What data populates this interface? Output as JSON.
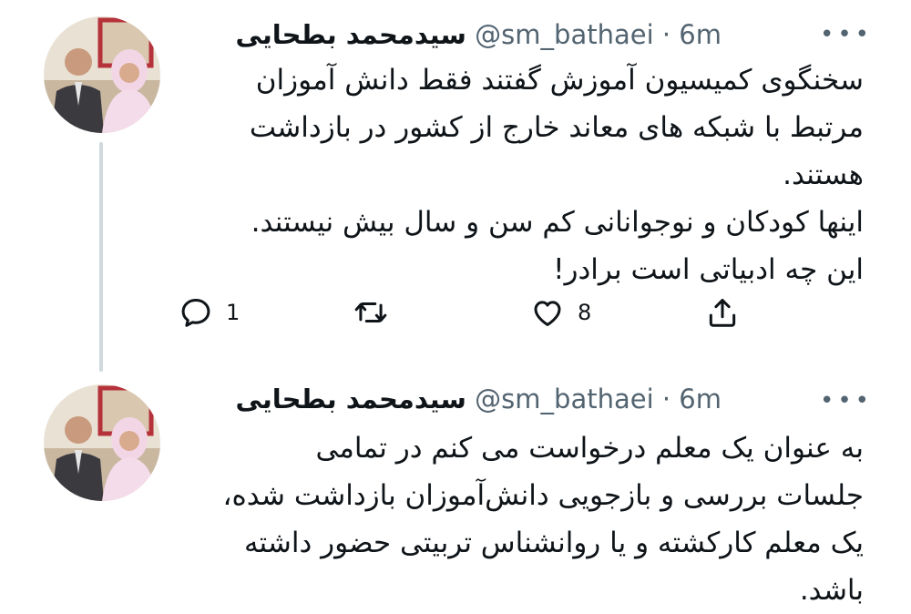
{
  "tweets": [
    {
      "display_name": "سیدمحمد بطحایی",
      "handle": "@sm_bathaei",
      "separator": "·",
      "time": "6m",
      "text": "سخنگوی کمیسیون آموزش گفتند فقط دانش آموزان\nمرتبط با شبکه های معاند خارج از کشور در بازداشت\nهستند.\nاینها کودکان و نوجوانانی کم سن و سال بیش نیستند.\nاین چه ادبیاتی است برادر!",
      "reply_count": "1",
      "like_count": "8",
      "icons": [
        "reply-icon",
        "retweet-icon",
        "like-icon",
        "share-icon",
        "more-icon"
      ]
    },
    {
      "display_name": "سیدمحمد بطحایی",
      "handle": "@sm_bathaei",
      "separator": "·",
      "time": "6m",
      "text": "به عنوان یک معلم درخواست می کنم در تمامی\nجلسات بررسی و بازجویی دانش‌آموزان بازداشت شده،\nیک معلم کارکشته و یا روانشناس تربیتی حضور داشته\nباشد.",
      "icons": [
        "more-icon"
      ]
    }
  ],
  "colors": {
    "text": "#0f1419",
    "secondary": "#536471",
    "thread_line": "#cfd9de"
  }
}
